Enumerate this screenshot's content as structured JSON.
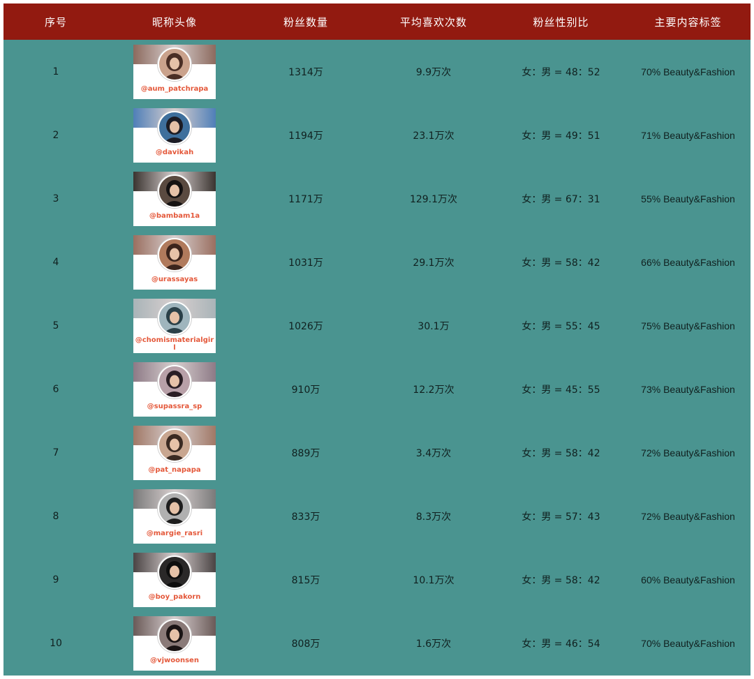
{
  "header": {
    "col_index": "序号",
    "col_profile": "昵称头像",
    "col_followers": "粉丝数量",
    "col_avg_likes": "平均喜欢次数",
    "col_gender": "粉丝性别比",
    "col_tags": "主要内容标签"
  },
  "colors": {
    "header_bg": "#921a10",
    "body_bg": "#4a9490",
    "handle": "#e4583a"
  },
  "rows": [
    {
      "index": "1",
      "handle": "@aum_patchrapa",
      "followers": "1314万",
      "avg_likes": "9.9万次",
      "gender": "女：男 = 48：52",
      "tags": "70% Beauty&Fashion",
      "banner": "#8c6a5e",
      "avatar": "#caa28c",
      "hair": "#4a2e25"
    },
    {
      "index": "2",
      "handle": "@davikah",
      "followers": "1194万",
      "avg_likes": "23.1万次",
      "gender": "女：男 = 49：51",
      "tags": "71% Beauty&Fashion",
      "banner": "#4f7fb8",
      "avatar": "#3e6f9c",
      "hair": "#1c1c24"
    },
    {
      "index": "3",
      "handle": "@bambam1a",
      "followers": "1171万",
      "avg_likes": "129.1万次",
      "gender": "女：男 = 67：31",
      "tags": "55% Beauty&Fashion",
      "banner": "#3a3430",
      "avatar": "#5a4a40",
      "hair": "#151212"
    },
    {
      "index": "4",
      "handle": "@urassayas",
      "followers": "1031万",
      "avg_likes": "29.1万次",
      "gender": "女：男 = 58：42",
      "tags": "66% Beauty&Fashion",
      "banner": "#9a6f60",
      "avatar": "#b07a5c",
      "hair": "#3b241c"
    },
    {
      "index": "5",
      "handle": "@chomismaterialgirl",
      "followers": "1026万",
      "avg_likes": "30.1万",
      "gender": "女：男 = 55：45",
      "tags": "75% Beauty&Fashion",
      "banner": "#a9b4b8",
      "avatar": "#9fb5bd",
      "hair": "#2a4048"
    },
    {
      "index": "6",
      "handle": "@supassra_sp",
      "followers": "910万",
      "avg_likes": "12.2万次",
      "gender": "女：男 = 45：55",
      "tags": "73% Beauty&Fashion",
      "banner": "#8d7a86",
      "avatar": "#b8a0a8",
      "hair": "#2a1e24"
    },
    {
      "index": "7",
      "handle": "@pat_napapa",
      "followers": "889万",
      "avg_likes": "3.4万次",
      "gender": "女：男 = 58：42",
      "tags": "72% Beauty&Fashion",
      "banner": "#a07866",
      "avatar": "#c8a690",
      "hair": "#3a2a22"
    },
    {
      "index": "8",
      "handle": "@margie_rasri",
      "followers": "833万",
      "avg_likes": "8.3万次",
      "gender": "女：男 = 57：43",
      "tags": "72% Beauty&Fashion",
      "banner": "#7a7a7a",
      "avatar": "#b0b0b0",
      "hair": "#1e1e1e"
    },
    {
      "index": "9",
      "handle": "@boy_pakorn",
      "followers": "815万",
      "avg_likes": "10.1万次",
      "gender": "女：男 = 58：42",
      "tags": "60% Beauty&Fashion",
      "banner": "#4a4444",
      "avatar": "#2a2828",
      "hair": "#0e0e0e"
    },
    {
      "index": "10",
      "handle": "@vjwoonsen",
      "followers": "808万",
      "avg_likes": "1.6万次",
      "gender": "女：男 = 46：54",
      "tags": "70% Beauty&Fashion",
      "banner": "#6a5a58",
      "avatar": "#8a7a78",
      "hair": "#1a1414"
    }
  ]
}
